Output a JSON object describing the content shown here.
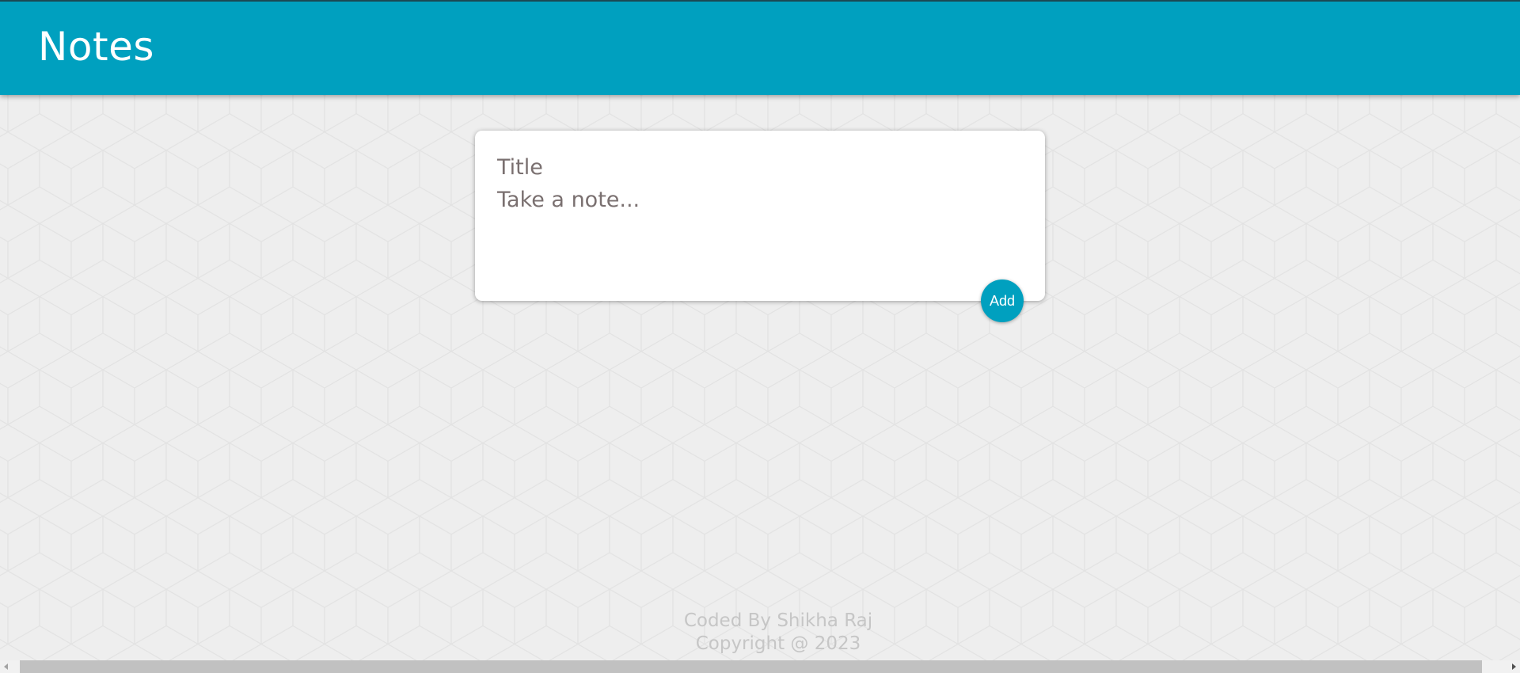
{
  "header": {
    "title": "Notes"
  },
  "note_form": {
    "title_placeholder": "Title",
    "content_placeholder": "Take a note...",
    "add_label": "Add"
  },
  "footer": {
    "credit": "Coded By Shikha Raj",
    "copyright": "Copyright @ 2023"
  },
  "icons": {
    "scroll_left": "scroll-left-arrow-icon",
    "scroll_right": "scroll-right-arrow-icon"
  },
  "colors": {
    "accent": "#00a0bf",
    "background": "#eeeeee",
    "card": "#ffffff",
    "footer_text": "#c6c6c6"
  }
}
